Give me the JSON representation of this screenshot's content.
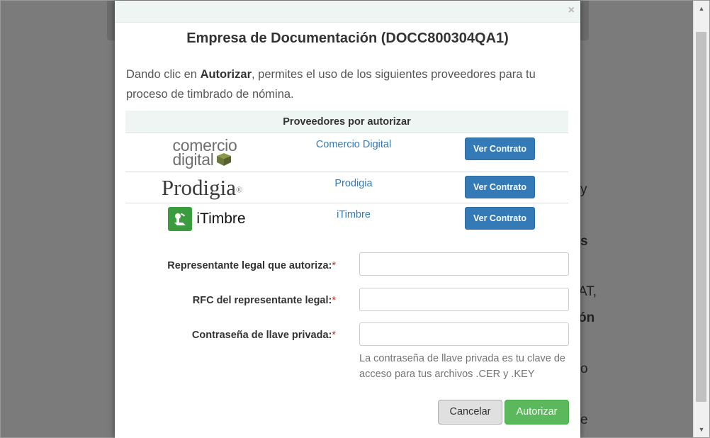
{
  "background": {
    "fragments": [
      {
        "text": "y",
        "bold": false
      },
      {
        "text": "s",
        "bold": true
      },
      {
        "text": "AT,",
        "bold": false
      },
      {
        "text": "ón",
        "bold": true
      },
      {
        "text": "o",
        "bold": false
      },
      {
        "text": "e",
        "bold": false
      }
    ]
  },
  "modal": {
    "close_symbol": "×",
    "title": "Empresa de Documentación (DOCC800304QA1)",
    "intro_before": "Dando clic en ",
    "intro_bold": "Autorizar",
    "intro_after": ", permites el uso de los siguientes proveedores para tu proceso de timbrado de nómina.",
    "table_header": "Proveedores por autorizar",
    "providers": [
      {
        "name": "Comercio Digital",
        "button": "Ver Contrato",
        "logo_line1": "comercio",
        "logo_line2": "digital"
      },
      {
        "name": "Prodigia",
        "button": "Ver Contrato",
        "logo_text": "Prodigia",
        "logo_mark": "®"
      },
      {
        "name": "iTimbre",
        "button": "Ver Contrato",
        "logo_text": "iTimbre"
      }
    ],
    "form": {
      "legal_rep_label": "Representante legal que autoriza:",
      "legal_rep_value": "",
      "rfc_label": "RFC del representante legal:",
      "rfc_value": "",
      "password_label": "Contraseña de llave privada:",
      "password_value": "",
      "required_mark": "*",
      "password_help": "La contraseña de llave privada es tu clave de acceso para tus archivos .CER y .KEY"
    },
    "cancel_label": "Cancelar",
    "authorize_label": "Autorizar"
  },
  "colors": {
    "primary": "#337ab7",
    "success": "#5cb85c",
    "header_bg": "#eef5f3",
    "overlay": "#7b7b7b",
    "itimbre_green": "#3a9c3f",
    "cd_cube_green": "#6b7a3a"
  },
  "icons": {
    "close": "close-icon",
    "scroll_up": "scroll-up-arrow-icon",
    "scroll_down": "scroll-down-arrow-icon"
  }
}
